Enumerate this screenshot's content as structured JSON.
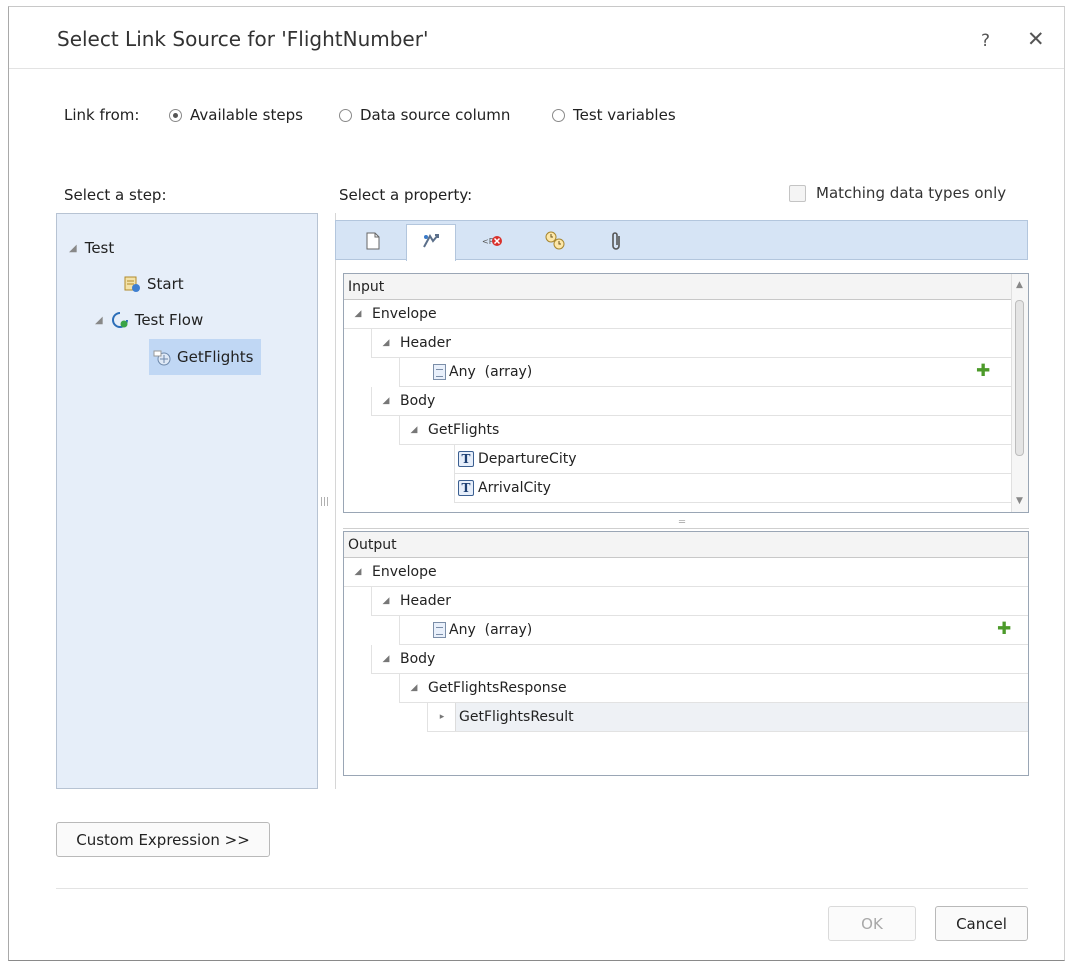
{
  "dialog": {
    "title": "Select Link Source for 'FlightNumber'",
    "help_label": "?",
    "close_label": "✕"
  },
  "link_from": {
    "label": "Link from:",
    "options": [
      {
        "label": "Available steps",
        "selected": true
      },
      {
        "label": "Data source column",
        "selected": false
      },
      {
        "label": "Test variables",
        "selected": false
      }
    ]
  },
  "step_panel": {
    "label": "Select a step:",
    "tree": [
      {
        "label": "Test",
        "expanded": true
      },
      {
        "label": "Start",
        "icon": "start-step-icon"
      },
      {
        "label": "Test Flow",
        "expanded": true,
        "icon": "test-flow-icon"
      },
      {
        "label": "GetFlights",
        "icon": "web-service-step-icon",
        "selected": true
      }
    ]
  },
  "property_panel": {
    "label": "Select a property:",
    "matching_label": "Matching data types only",
    "matching_checked": false,
    "tabs": [
      {
        "icon": "properties-page-icon",
        "active": false
      },
      {
        "icon": "input-output-icon",
        "active": true
      },
      {
        "icon": "xml-checkpoint-icon",
        "active": false
      },
      {
        "icon": "events-icon",
        "active": false
      },
      {
        "icon": "attachment-icon",
        "active": false
      }
    ]
  },
  "input_grid": {
    "header": "Input",
    "rows": [
      {
        "label": "Envelope"
      },
      {
        "label": "Header"
      },
      {
        "label": "Any  (array)",
        "has_add": true
      },
      {
        "label": "Body"
      },
      {
        "label": "GetFlights"
      },
      {
        "label": "DepartureCity"
      },
      {
        "label": "ArrivalCity"
      }
    ]
  },
  "output_grid": {
    "header": "Output",
    "rows": [
      {
        "label": "Envelope"
      },
      {
        "label": "Header"
      },
      {
        "label": "Any  (array)",
        "has_add": true
      },
      {
        "label": "Body"
      },
      {
        "label": "GetFlightsResponse"
      },
      {
        "label": "GetFlightsResult"
      }
    ]
  },
  "buttons": {
    "custom_expression": "Custom Expression >>",
    "ok": "OK",
    "ok_enabled": false,
    "cancel": "Cancel"
  },
  "colors": {
    "tree_background": "#e6eef9",
    "tree_selection": "#c0d7f4",
    "tab_bar": "#d6e4f5",
    "add_icon": "#4c9a2a"
  }
}
